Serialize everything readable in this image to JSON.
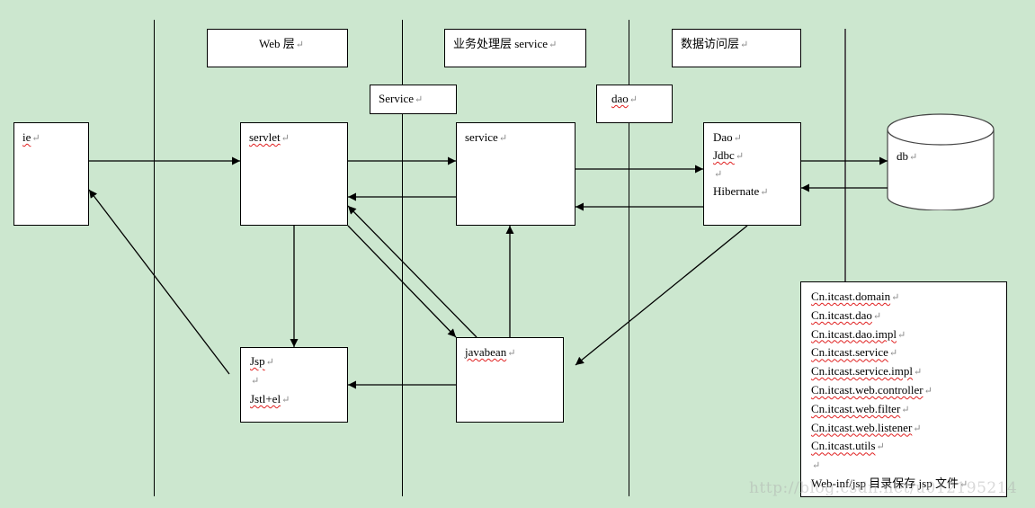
{
  "layers": {
    "web": "Web 层",
    "business": "业务处理层  service",
    "data_access": "数据访问层"
  },
  "interfaces": {
    "service": "Service",
    "dao": "dao"
  },
  "components": {
    "ie": "ie",
    "servlet": "servlet",
    "service": "service",
    "dao_lines": [
      "Dao",
      "Jdbc",
      "",
      "Hibernate"
    ],
    "db": "db",
    "jsp_lines": [
      "Jsp",
      "",
      "Jstl+el"
    ],
    "javabean": "javabean"
  },
  "packages": [
    "Cn.itcast.domain",
    "Cn.itcast.dao",
    "Cn.itcast.dao.impl",
    "Cn.itcast.service",
    "Cn.itcast.service.impl",
    "Cn.itcast.web.controller",
    "Cn.itcast.web.filter",
    "Cn.itcast.web.listener",
    "Cn.itcast.utils",
    "",
    "Web-inf/jsp 目录保存 jsp 文件"
  ],
  "paragraph_mark": "↵",
  "watermark": "http://blog.csdn.net/u012195214",
  "colors": {
    "background": "#cce7cf",
    "box": "#ffffff",
    "line": "#000000",
    "spellcheck": "#e02020"
  }
}
